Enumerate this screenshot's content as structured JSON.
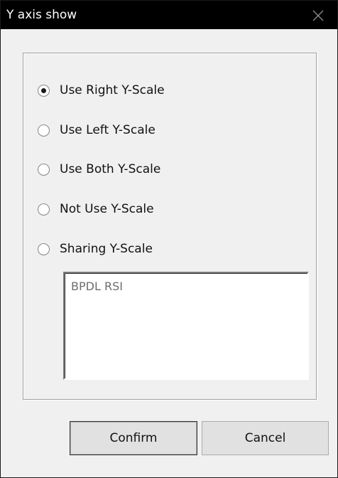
{
  "window": {
    "title": "Y axis show",
    "close_icon": "close-icon"
  },
  "options": [
    {
      "label": "Use Right Y-Scale",
      "checked": true
    },
    {
      "label": "Use Left Y-Scale",
      "checked": false
    },
    {
      "label": "Use Both Y-Scale",
      "checked": false
    },
    {
      "label": "Not Use Y-Scale",
      "checked": false
    },
    {
      "label": "Sharing Y-Scale",
      "checked": false
    }
  ],
  "list": {
    "items": [
      "BPDL RSI"
    ]
  },
  "buttons": {
    "confirm_label": "Confirm",
    "cancel_label": "Cancel"
  }
}
